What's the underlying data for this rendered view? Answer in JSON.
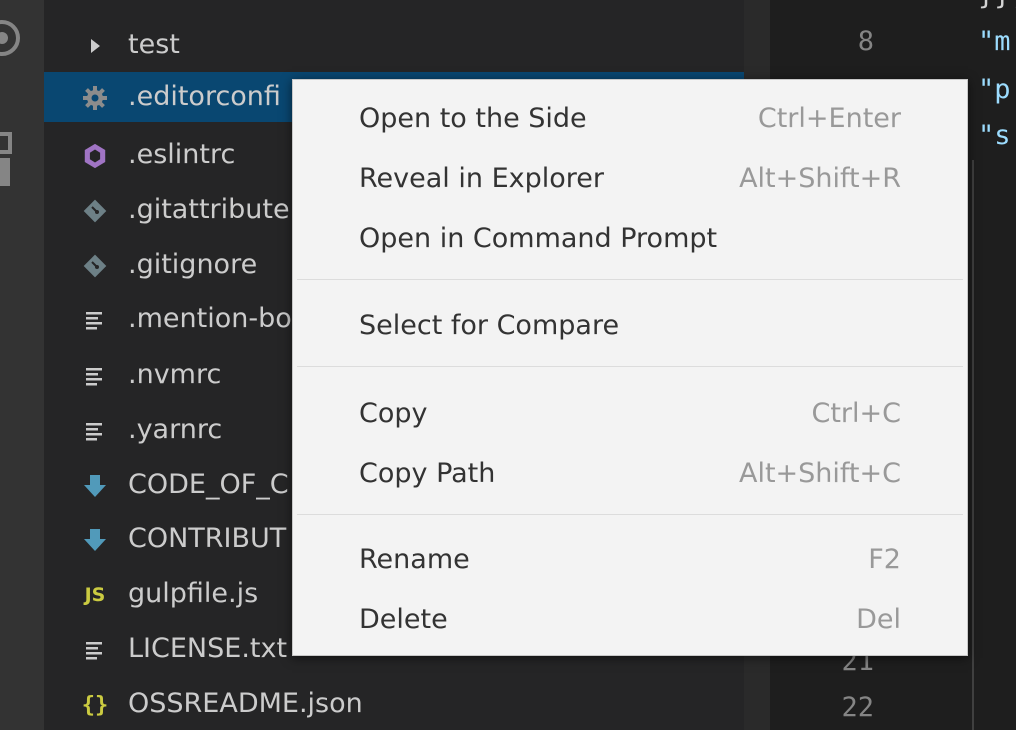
{
  "explorer": {
    "items": [
      {
        "label": "test",
        "icon": "chevron-right-icon"
      },
      {
        "label": ".editorconfi",
        "icon": "gear-icon",
        "selected": true
      },
      {
        "label": ".eslintrc",
        "icon": "eslint-icon"
      },
      {
        "label": ".gitattribute",
        "icon": "git-icon"
      },
      {
        "label": ".gitignore",
        "icon": "git-icon"
      },
      {
        "label": ".mention-bo",
        "icon": "text-file-icon"
      },
      {
        "label": ".nvmrc",
        "icon": "text-file-icon"
      },
      {
        "label": ".yarnrc",
        "icon": "text-file-icon"
      },
      {
        "label": "CODE_OF_C",
        "icon": "markdown-icon"
      },
      {
        "label": "CONTRIBUT",
        "icon": "markdown-icon"
      },
      {
        "label": "gulpfile.js",
        "icon": "javascript-icon",
        "badge": "JS"
      },
      {
        "label": "LICENSE.txt",
        "icon": "text-file-icon"
      },
      {
        "label": "OSSREADME.json",
        "icon": "json-icon",
        "badge": "{}"
      }
    ]
  },
  "editor": {
    "line_numbers": [
      "8",
      "21",
      "22"
    ],
    "code_lines": [
      "}},",
      "\"m",
      "\"p",
      "\"s"
    ]
  },
  "context_menu": {
    "groups": [
      [
        {
          "label": "Open to the Side",
          "shortcut": "Ctrl+Enter"
        },
        {
          "label": "Reveal in Explorer",
          "shortcut": "Alt+Shift+R"
        },
        {
          "label": "Open in Command Prompt",
          "shortcut": ""
        }
      ],
      [
        {
          "label": "Select for Compare",
          "shortcut": ""
        }
      ],
      [
        {
          "label": "Copy",
          "shortcut": "Ctrl+C"
        },
        {
          "label": "Copy Path",
          "shortcut": "Alt+Shift+C"
        }
      ],
      [
        {
          "label": "Rename",
          "shortcut": "F2"
        },
        {
          "label": "Delete",
          "shortcut": "Del"
        }
      ]
    ]
  },
  "colors": {
    "selection": "#094771",
    "sidebar": "#252526",
    "menu_bg": "#f3f3f3",
    "markdown_icon": "#519aba",
    "eslint_icon": "#a074c4",
    "js_icon": "#cbcb41"
  }
}
